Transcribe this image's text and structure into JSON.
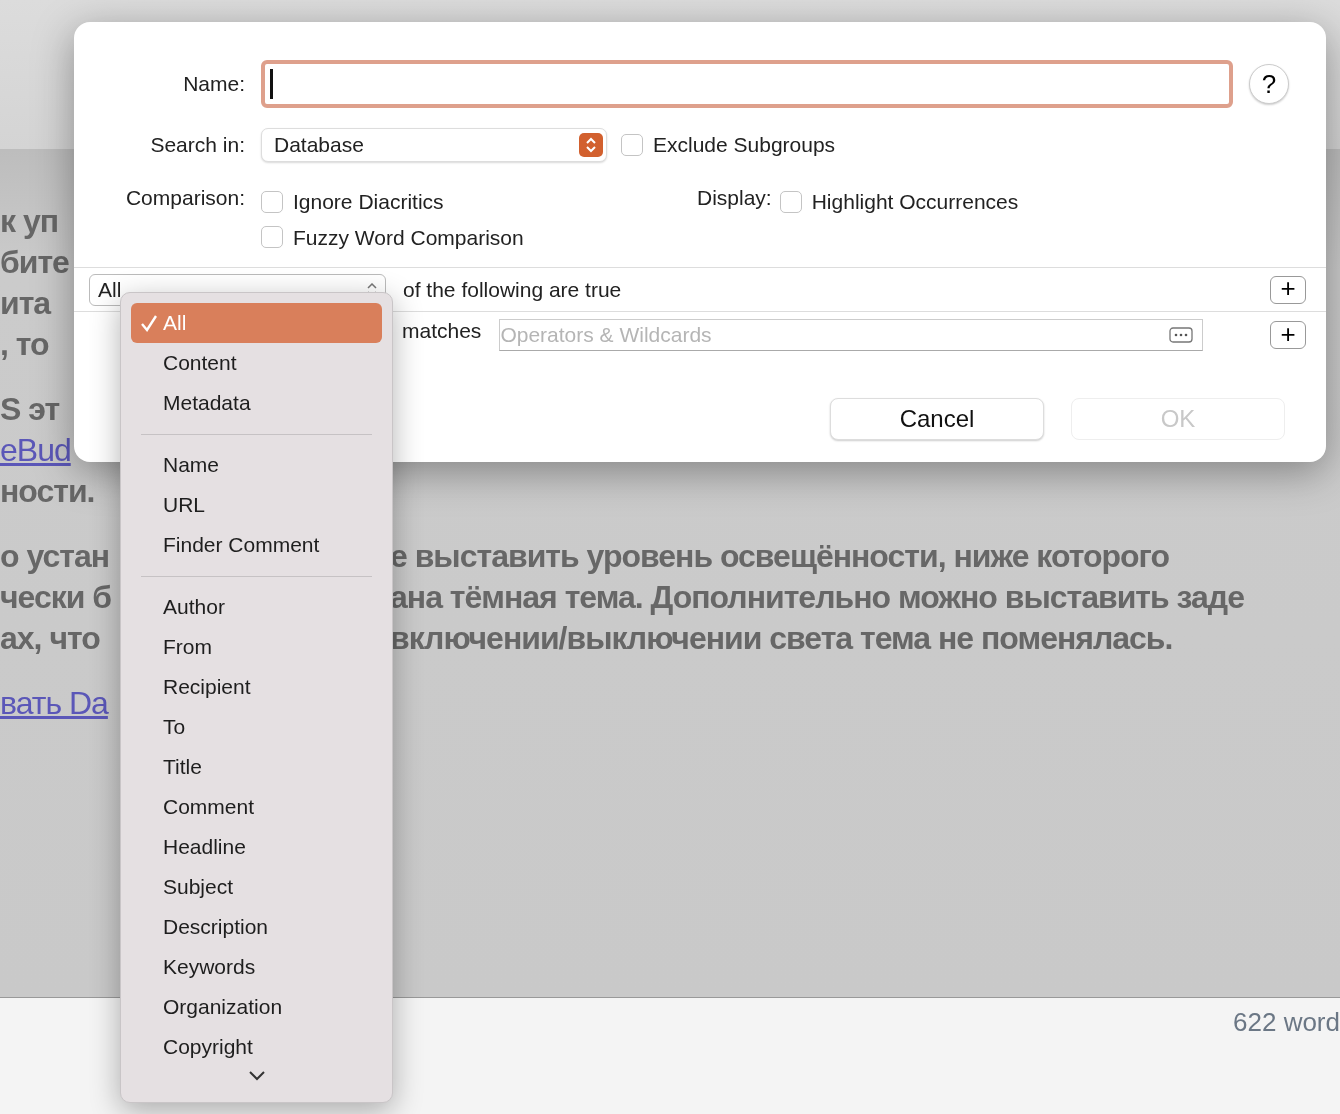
{
  "document": {
    "lines": [
      {
        "kind": "text",
        "left": "к уп"
      },
      {
        "kind": "text",
        "left": "бите"
      },
      {
        "kind": "text",
        "left": "ита"
      },
      {
        "kind": "text",
        "left": ", то"
      },
      {
        "kind": "gap"
      },
      {
        "kind": "text",
        "left": "S эт"
      },
      {
        "kind": "link",
        "left": "eBud"
      },
      {
        "kind": "text",
        "left": "ности."
      },
      {
        "kind": "gap"
      },
      {
        "kind": "text",
        "left": "о устан",
        "right": "е выставить уровень освещённости, ниже которого"
      },
      {
        "kind": "text",
        "left": "чески б",
        "right": "ана тёмная тема. Дополнительно можно выставить заде"
      },
      {
        "kind": "text",
        "left": "ах, что",
        "right": "включении/выключении света тема не поменялась."
      },
      {
        "kind": "gap"
      },
      {
        "kind": "link",
        "left": "вать Da"
      }
    ],
    "word_count": "622 word"
  },
  "dialog": {
    "name_label": "Name:",
    "help_button": "?",
    "search_in_label": "Search in:",
    "search_in_value": "Database",
    "exclude_subgroups": {
      "label": "Exclude Subgroups",
      "checked": false
    },
    "comparison_label": "Comparison:",
    "comparison_options": [
      {
        "label": "Ignore Diacritics",
        "checked": false
      },
      {
        "label": "Fuzzy Word Comparison",
        "checked": false
      }
    ],
    "display_label": "Display:",
    "display_options": [
      {
        "label": "Highlight Occurrences",
        "checked": false
      }
    ],
    "criteria": {
      "quantifier": "All",
      "suffix": "of the following are true",
      "add_button": "+"
    },
    "condition": {
      "operator": "matches",
      "placeholder": "Operators & Wildcards",
      "add_button": "+"
    },
    "buttons": [
      {
        "label": "Cancel",
        "disabled": false
      },
      {
        "label": "OK",
        "disabled": true
      }
    ]
  },
  "menu": {
    "items": [
      {
        "kind": "item",
        "label": "All",
        "selected": true
      },
      {
        "kind": "item",
        "label": "Content",
        "selected": false
      },
      {
        "kind": "item",
        "label": "Metadata",
        "selected": false
      },
      {
        "kind": "separator"
      },
      {
        "kind": "item",
        "label": "Name",
        "selected": false
      },
      {
        "kind": "item",
        "label": "URL",
        "selected": false
      },
      {
        "kind": "item",
        "label": "Finder Comment",
        "selected": false
      },
      {
        "kind": "separator"
      },
      {
        "kind": "item",
        "label": "Author",
        "selected": false
      },
      {
        "kind": "item",
        "label": "From",
        "selected": false
      },
      {
        "kind": "item",
        "label": "Recipient",
        "selected": false
      },
      {
        "kind": "item",
        "label": "To",
        "selected": false
      },
      {
        "kind": "item",
        "label": "Title",
        "selected": false
      },
      {
        "kind": "item",
        "label": "Comment",
        "selected": false
      },
      {
        "kind": "item",
        "label": "Headline",
        "selected": false
      },
      {
        "kind": "item",
        "label": "Subject",
        "selected": false
      },
      {
        "kind": "item",
        "label": "Description",
        "selected": false
      },
      {
        "kind": "item",
        "label": "Keywords",
        "selected": false
      },
      {
        "kind": "item",
        "label": "Organization",
        "selected": false
      },
      {
        "kind": "item",
        "label": "Copyright",
        "selected": false
      }
    ]
  }
}
